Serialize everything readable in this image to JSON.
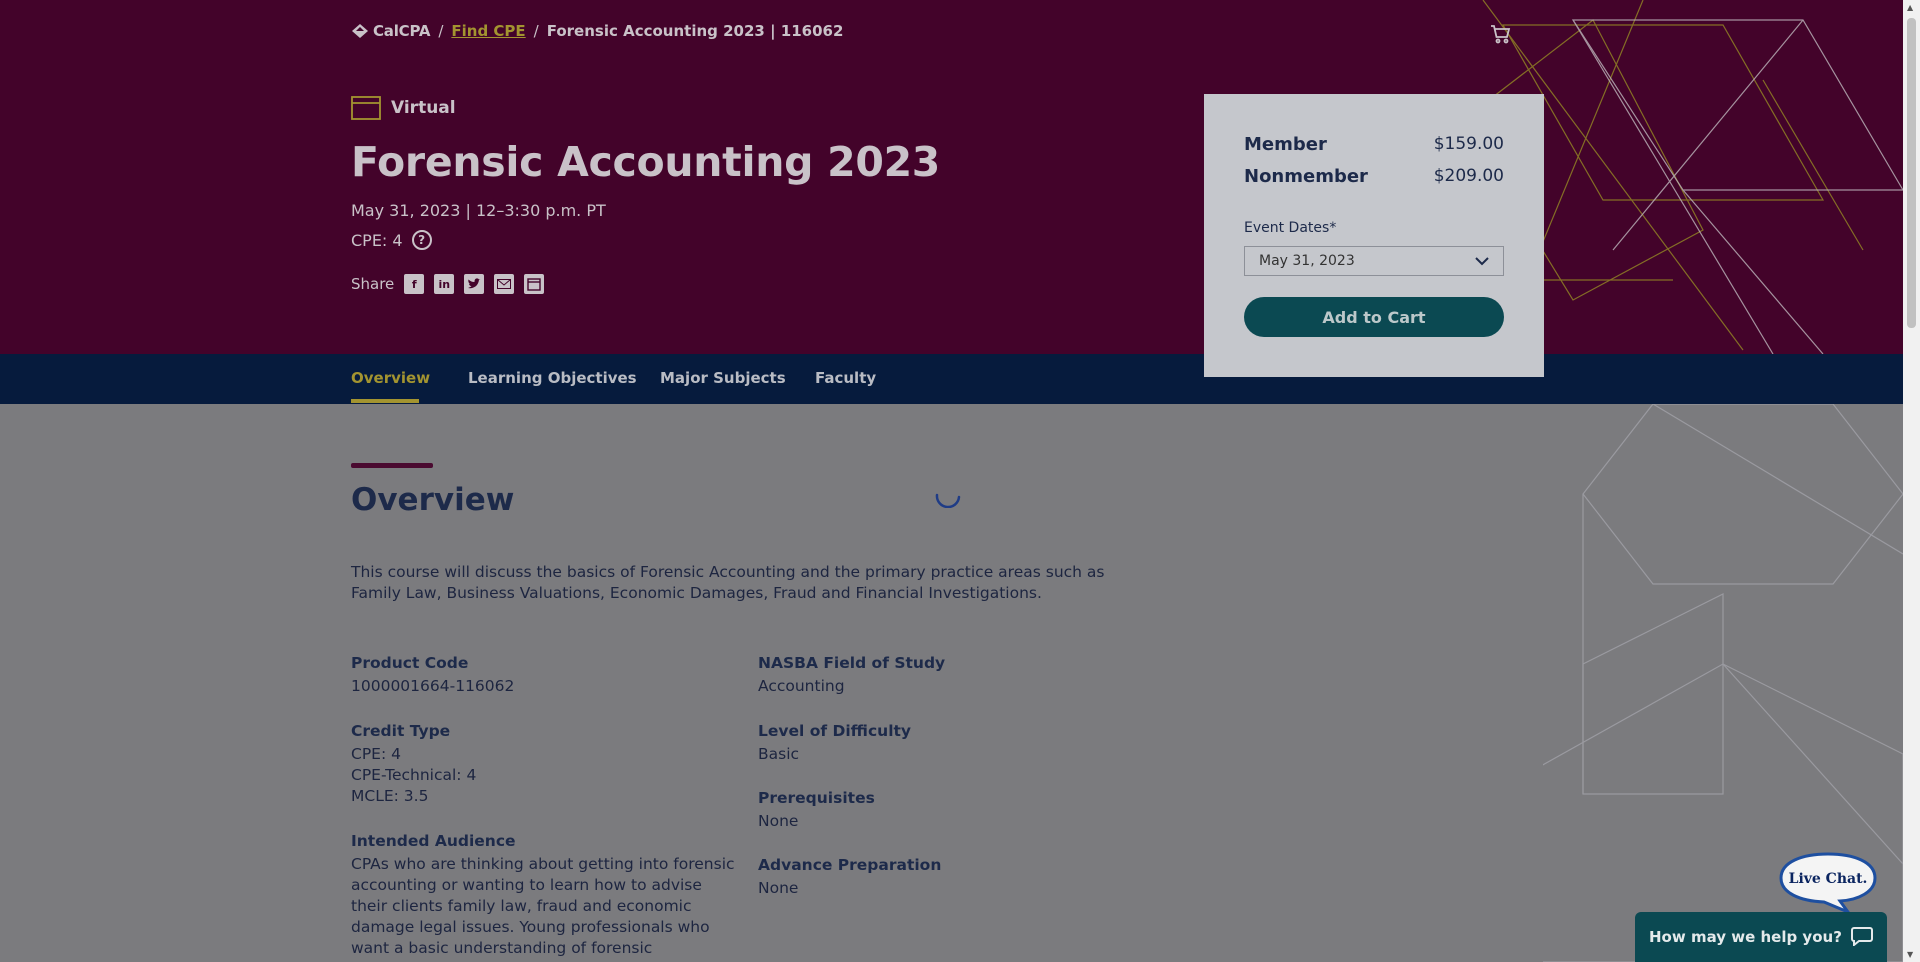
{
  "breadcrumb": {
    "logo": "CalCPA",
    "link": "Find CPE",
    "current": "Forensic Accounting 2023 | 116062"
  },
  "hero": {
    "format": "Virtual",
    "title": "Forensic Accounting 2023",
    "date": "May 31, 2023 | 12–3:30 p.m. PT",
    "cpe": "CPE: 4",
    "help_glyph": "?",
    "share_label": "Share",
    "share_icons": [
      "facebook-icon",
      "linkedin-icon",
      "twitter-icon",
      "email-icon",
      "calendar-icon"
    ]
  },
  "tabs": [
    {
      "label": "Overview",
      "active": true
    },
    {
      "label": "Learning Objectives",
      "active": false
    },
    {
      "label": "Major Subjects",
      "active": false
    },
    {
      "label": "Faculty",
      "active": false
    }
  ],
  "pricing": {
    "member_label": "Member",
    "member_price": "$159.00",
    "nonmember_label": "Nonmember",
    "nonmember_price": "$209.00",
    "event_dates_label": "Event Dates*",
    "selected_date": "May 31, 2023",
    "add_to_cart": "Add to Cart"
  },
  "overview": {
    "heading": "Overview",
    "description": "This course will discuss the basics of Forensic Accounting and the primary practice areas such as Family Law, Business Valuations, Economic Damages, Fraud and Financial Investigations.",
    "product_code_label": "Product Code",
    "product_code": "1000001664-116062",
    "credit_type_label": "Credit Type",
    "credit_types": [
      "CPE: 4",
      "CPE-Technical: 4",
      "MCLE: 3.5"
    ],
    "audience_label": "Intended Audience",
    "audience_lines": [
      "CPAs who are thinking about getting into forensic",
      "accounting or wanting to learn how to advise",
      "their clients family law, fraud and economic",
      "damage legal issues. Young professionals who",
      "want a basic understanding of forensic"
    ],
    "field_of_study_label": "NASBA Field of Study",
    "field_of_study": "Accounting",
    "difficulty_label": "Level of Difficulty",
    "difficulty": "Basic",
    "prerequisites_label": "Prerequisites",
    "prerequisites": "None",
    "advance_prep_label": "Advance Preparation",
    "advance_prep": "None"
  },
  "chat": {
    "bubble": "Live Chat.",
    "prompt": "How may we help you?"
  },
  "colors": {
    "hero_bg": "#43032a",
    "nav_bg": "#061b3d",
    "accent_gold": "#a39430",
    "button_teal": "#0b4952"
  }
}
